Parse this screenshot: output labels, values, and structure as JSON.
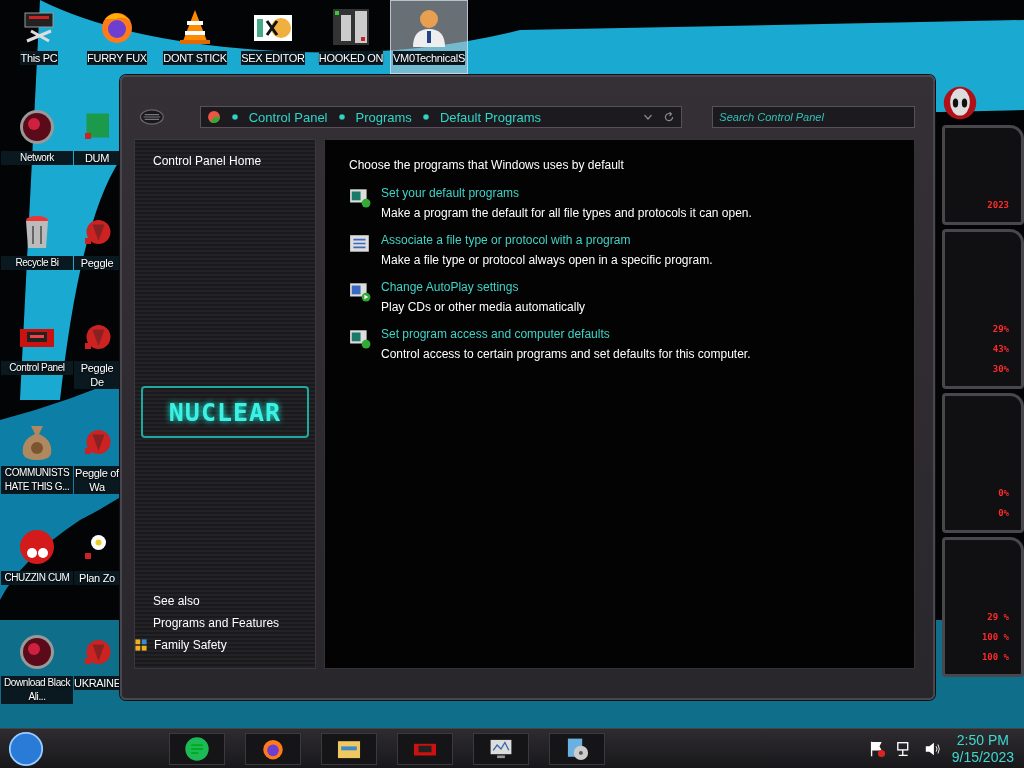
{
  "desktop_top": [
    {
      "label": "This PC",
      "kind": "pc",
      "selected": false
    },
    {
      "label": "FURRY FUX",
      "kind": "firefox",
      "selected": false
    },
    {
      "label": "DONT STICK",
      "kind": "cone",
      "selected": false
    },
    {
      "label": "SEX EDITOR",
      "kind": "hex",
      "selected": false
    },
    {
      "label": "HOOKED ON",
      "kind": "maze",
      "selected": false
    },
    {
      "label": "VM0TechnicalS",
      "kind": "person",
      "selected": true
    }
  ],
  "desktop_left": [
    {
      "label": "Network",
      "kind": "orb"
    },
    {
      "label": "Recycle Bi",
      "kind": "bin"
    },
    {
      "label": "Control Panel",
      "kind": "panel"
    },
    {
      "label": "COMMUNISTS HATE THIS G...",
      "kind": "money"
    },
    {
      "label": "CHUZZIN CUM",
      "kind": "fuzz"
    },
    {
      "label": "Download Black Ali...",
      "kind": "orb"
    }
  ],
  "desktop_partial": [
    {
      "label": "DUM",
      "kind": "green"
    },
    {
      "label": "Peggle",
      "kind": "red"
    },
    {
      "label": "Peggle De",
      "kind": "red"
    },
    {
      "label": "Peggle of Wa",
      "kind": "red"
    },
    {
      "label": "Plan Zo",
      "kind": "flower"
    },
    {
      "label": "UKRAINE",
      "kind": "red"
    }
  ],
  "window": {
    "breadcrumb": [
      "Control Panel",
      "Programs",
      "Default Programs"
    ],
    "search": {
      "placeholder": "Search Control Panel"
    },
    "nav": {
      "home": "Control Panel Home",
      "logo": "NUCLEAR",
      "see_also": "See also",
      "links": [
        {
          "label": "Programs and Features",
          "kind": "plain"
        },
        {
          "label": "Family Safety",
          "kind": "shield"
        }
      ]
    },
    "heading": "Choose the programs that Windows uses by default",
    "tasks": [
      {
        "title": "Set your default programs",
        "description": "Make a program the default for all file types and protocols it can open.",
        "kind": "check"
      },
      {
        "title": "Associate a file type or protocol with a program",
        "description": "Make a file type or protocol always open in a specific program.",
        "kind": "list"
      },
      {
        "title": "Change AutoPlay settings",
        "description": "Play CDs or other media automatically",
        "kind": "play"
      },
      {
        "title": "Set program access and computer defaults",
        "description": "Control access to certain programs and set defaults for this computer.",
        "kind": "check"
      }
    ]
  },
  "gadget": {
    "groups": [
      [
        "2023"
      ],
      [
        "29%",
        "43%",
        "30%"
      ],
      [
        "0%",
        "0%"
      ],
      [
        "29 %",
        "100 %",
        "100 %"
      ]
    ]
  },
  "taskbar": {
    "apps": [
      {
        "kind": "music"
      },
      {
        "kind": "firefox"
      },
      {
        "kind": "folder"
      },
      {
        "kind": "panel"
      },
      {
        "kind": "monitor"
      },
      {
        "kind": "disc"
      }
    ],
    "tray": [
      {
        "kind": "flag"
      },
      {
        "kind": "network"
      },
      {
        "kind": "volume"
      }
    ],
    "time": "2:50 PM",
    "date": "9/15/2023"
  }
}
